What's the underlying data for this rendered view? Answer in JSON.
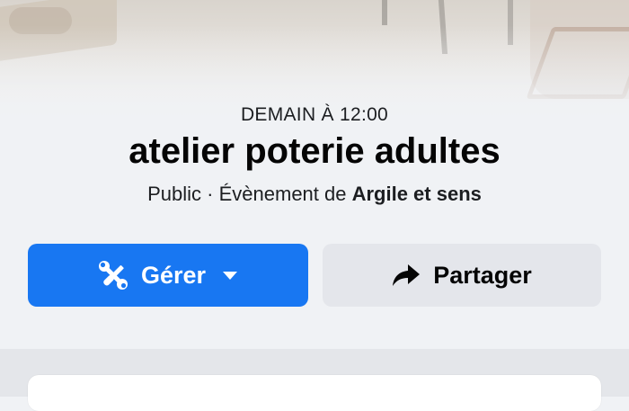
{
  "event": {
    "date": "DEMAIN À 12:00",
    "title": "atelier poterie adultes",
    "privacy": "Public",
    "separator": " · ",
    "organizer_prefix": "Évènement de ",
    "organizer": "Argile et sens"
  },
  "actions": {
    "manage_label": "Gérer",
    "share_label": "Partager",
    "manage_icon": "tools-icon",
    "share_icon": "share-arrow-icon"
  },
  "colors": {
    "primary": "#1877f2",
    "secondary_button": "#e4e6eb",
    "background": "#f0f2f5"
  }
}
